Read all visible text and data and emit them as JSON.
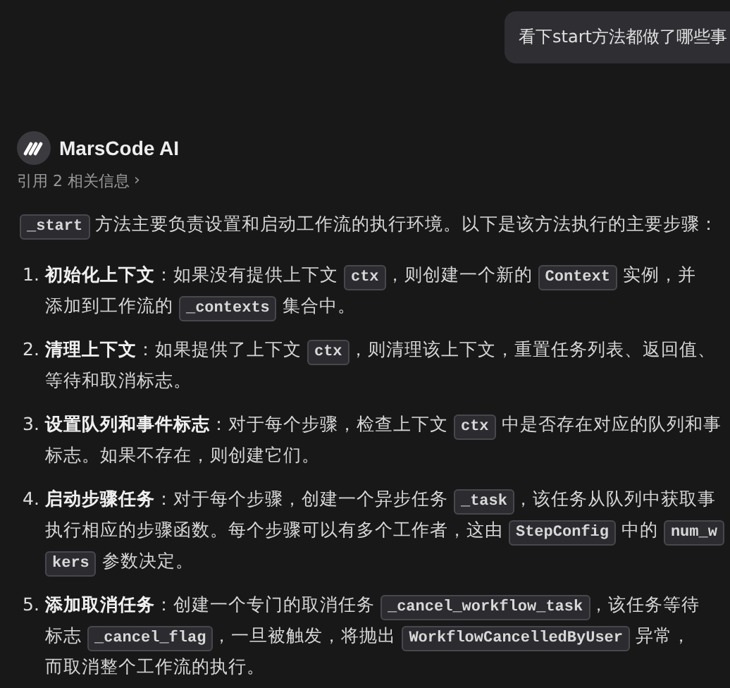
{
  "user_message": {
    "text": "看下start方法都做了哪些事"
  },
  "assistant": {
    "name": "MarsCode AI",
    "references": {
      "label": "引用 2 相关信息",
      "chevron": "›"
    }
  },
  "intro": [
    {
      "kind": "code",
      "text": "_start"
    },
    {
      "kind": "text",
      "text": " 方法主要负责设置和启动工作流的执行环境。以下是该方法执行的主要步骤："
    }
  ],
  "steps": [
    {
      "number": "1.",
      "lines": [
        [
          {
            "kind": "bold",
            "text": "初始化上下文"
          },
          {
            "kind": "text",
            "text": "：如果没有提供上下文 "
          },
          {
            "kind": "code",
            "text": "ctx"
          },
          {
            "kind": "text",
            "text": "，则创建一个新的 "
          },
          {
            "kind": "code",
            "text": "Context"
          },
          {
            "kind": "text",
            "text": " 实例，并"
          }
        ],
        [
          {
            "kind": "text",
            "text": "添加到工作流的 "
          },
          {
            "kind": "code",
            "text": "_contexts"
          },
          {
            "kind": "text",
            "text": " 集合中。"
          }
        ]
      ]
    },
    {
      "number": "2.",
      "lines": [
        [
          {
            "kind": "bold",
            "text": "清理上下文"
          },
          {
            "kind": "text",
            "text": "：如果提供了上下文 "
          },
          {
            "kind": "code",
            "text": "ctx"
          },
          {
            "kind": "text",
            "text": "，则清理该上下文，重置任务列表、返回值、"
          }
        ],
        [
          {
            "kind": "text",
            "text": "等待和取消标志。"
          }
        ]
      ]
    },
    {
      "number": "3.",
      "lines": [
        [
          {
            "kind": "bold",
            "text": "设置队列和事件标志"
          },
          {
            "kind": "text",
            "text": "：对于每个步骤，检查上下文 "
          },
          {
            "kind": "code",
            "text": "ctx"
          },
          {
            "kind": "text",
            "text": " 中是否存在对应的队列和事"
          }
        ],
        [
          {
            "kind": "text",
            "text": "标志。如果不存在，则创建它们。"
          }
        ]
      ]
    },
    {
      "number": "4.",
      "lines": [
        [
          {
            "kind": "bold",
            "text": "启动步骤任务"
          },
          {
            "kind": "text",
            "text": "：对于每个步骤，创建一个异步任务 "
          },
          {
            "kind": "code",
            "text": "_task"
          },
          {
            "kind": "text",
            "text": "，该任务从队列中获取事"
          }
        ],
        [
          {
            "kind": "text",
            "text": "执行相应的步骤函数。每个步骤可以有多个工作者，这由 "
          },
          {
            "kind": "code",
            "text": "StepConfig"
          },
          {
            "kind": "text",
            "text": " 中的 "
          },
          {
            "kind": "code",
            "text": "num_w"
          }
        ],
        [
          {
            "kind": "code",
            "text": "kers"
          },
          {
            "kind": "text",
            "text": " 参数决定。"
          }
        ]
      ]
    },
    {
      "number": "5.",
      "lines": [
        [
          {
            "kind": "bold",
            "text": "添加取消任务"
          },
          {
            "kind": "text",
            "text": "：创建一个专门的取消任务 "
          },
          {
            "kind": "code",
            "text": "_cancel_workflow_task"
          },
          {
            "kind": "text",
            "text": "，该任务等待"
          }
        ],
        [
          {
            "kind": "text",
            "text": "标志 "
          },
          {
            "kind": "code",
            "text": "_cancel_flag"
          },
          {
            "kind": "text",
            "text": "，一旦被触发，将抛出 "
          },
          {
            "kind": "code",
            "text": "WorkflowCancelledByUser"
          },
          {
            "kind": "text",
            "text": " 异常，"
          }
        ],
        [
          {
            "kind": "text",
            "text": "而取消整个工作流的执行。"
          }
        ]
      ]
    }
  ]
}
